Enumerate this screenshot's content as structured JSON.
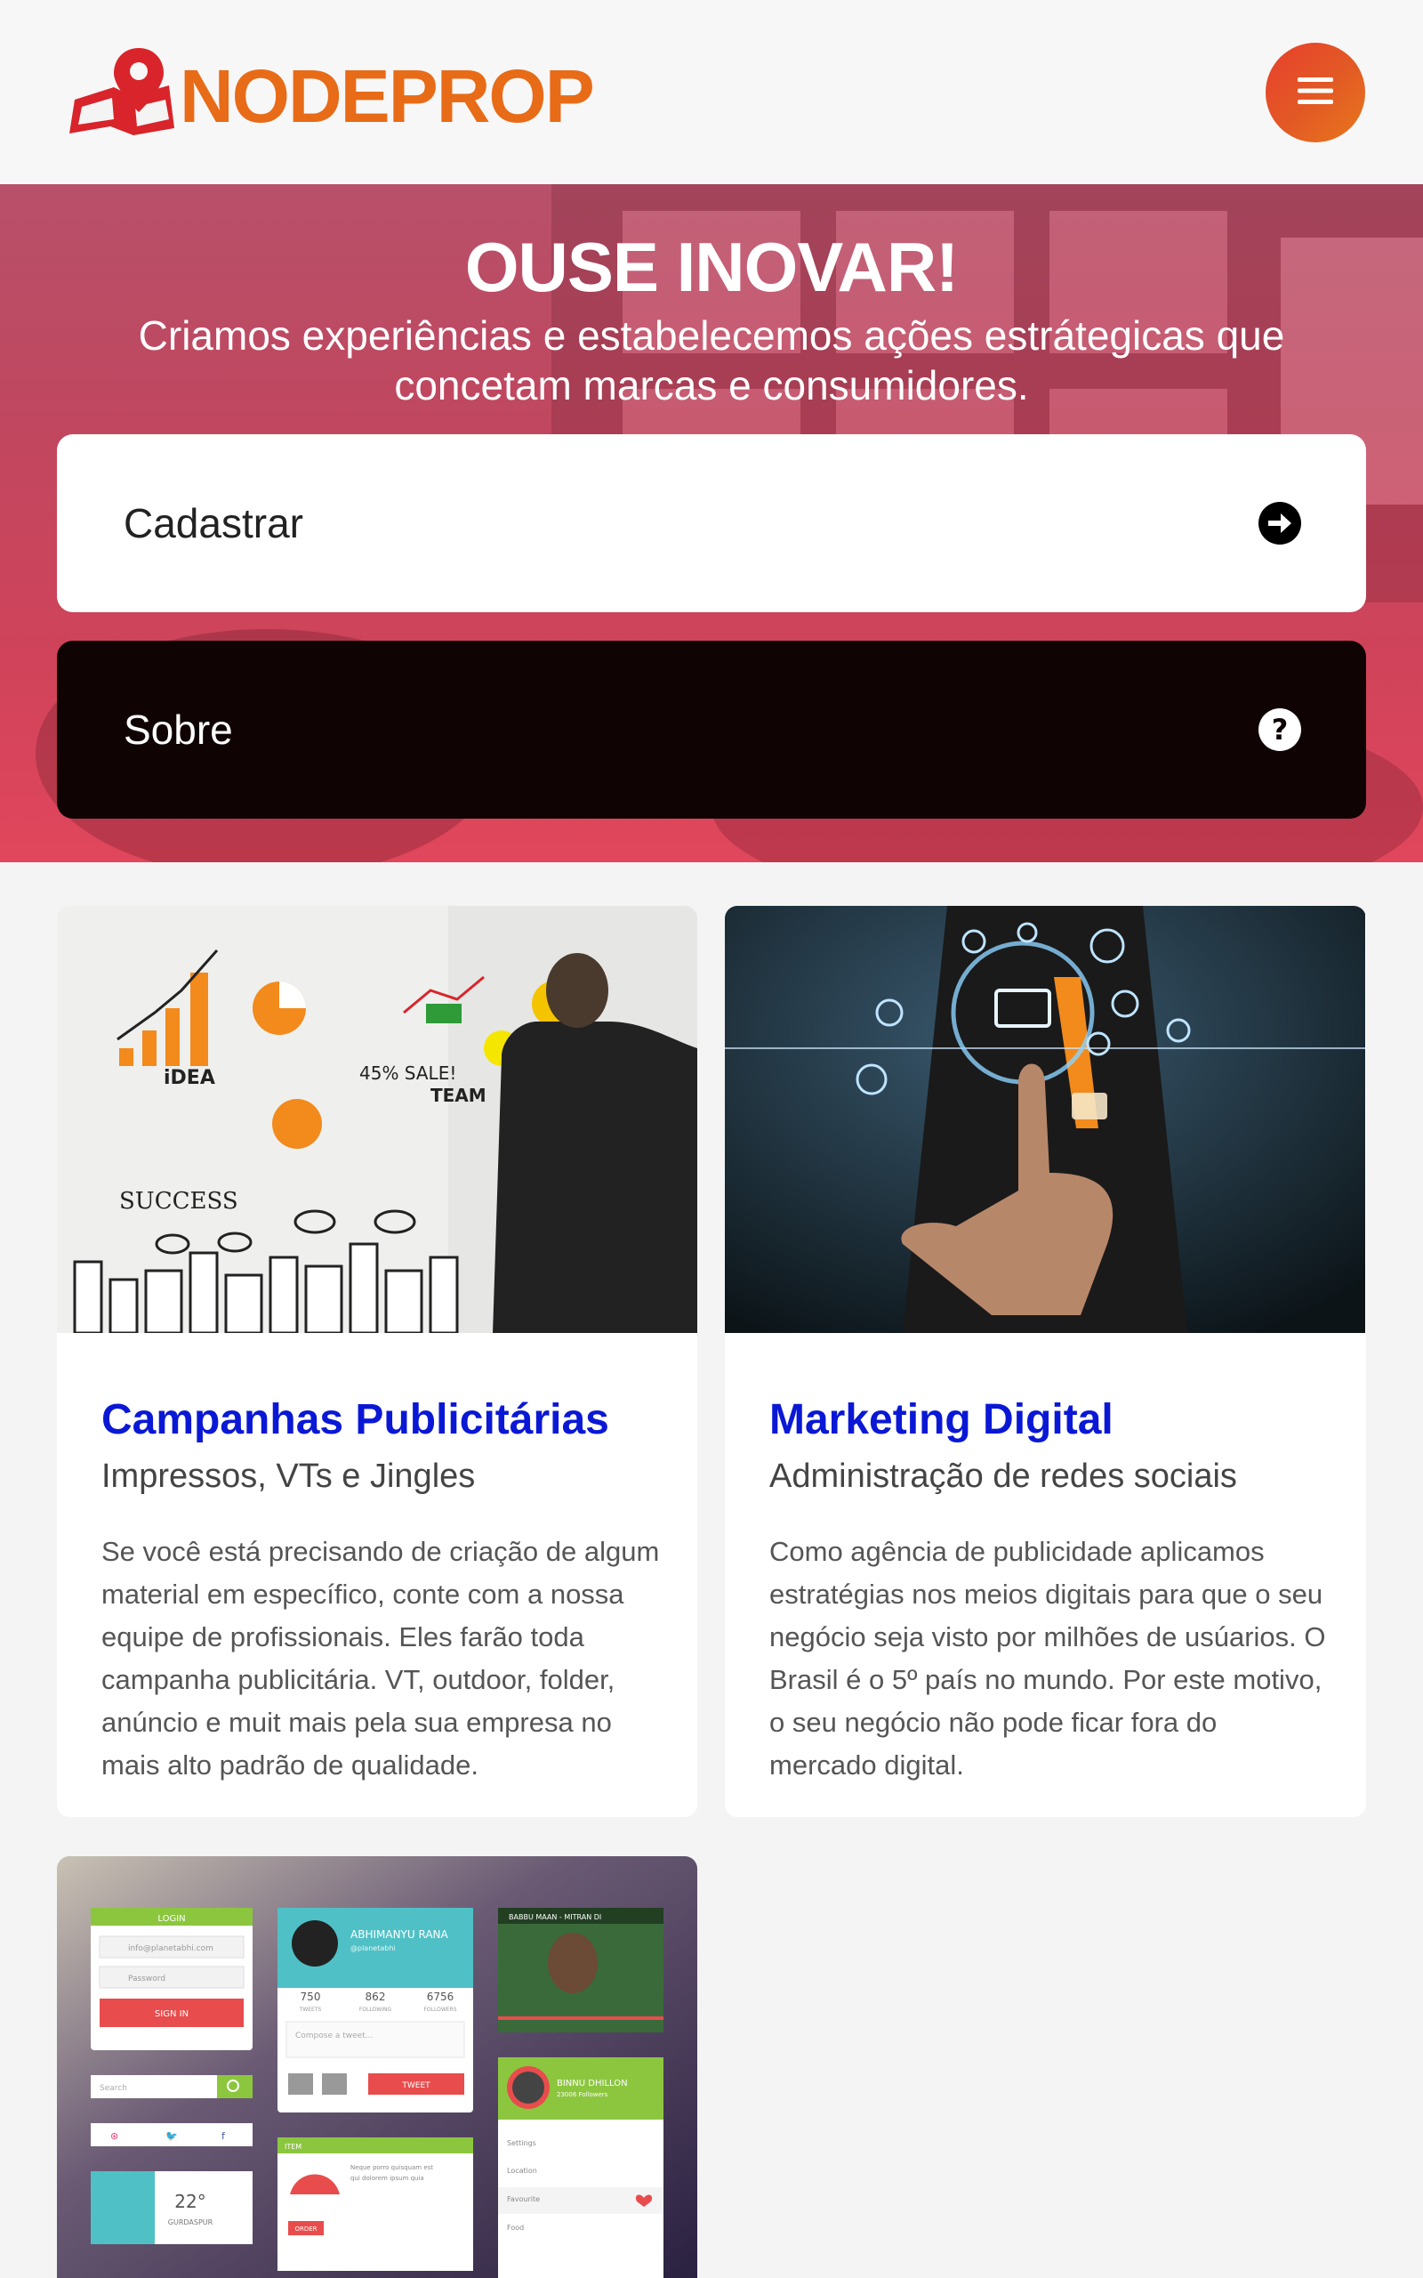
{
  "header": {
    "logo_text": "NODEPROP",
    "menu_icon": "hamburger-icon",
    "brand_color": "#e86b17"
  },
  "hero": {
    "title": "OUSE INOVAR!",
    "subtitle": "Criamos experiências e estabelecemos ações estrátegicas que concetam marcas e consumidores.",
    "cadastrar_label": "Cadastrar",
    "cadastrar_icon": "arrow-circle-right-icon",
    "sobre_label": "Sobre",
    "sobre_icon": "question-circle-icon"
  },
  "cards": [
    {
      "title": "Campanhas Publicitárias",
      "subtitle": "Impressos, VTs e Jingles",
      "text": "Se você está precisando de criação de algum material em específico, conte com a nossa equipe de profissionais. Eles farão toda campanha publicitária. VT, outdoor, folder, anúncio e muit mais pela sua empresa no mais alto padrão de qualidade."
    },
    {
      "title": "Marketing Digital",
      "subtitle": "Administração de redes sociais",
      "text": "Como agência de publicidade aplicamos estratégias nos meios digitais para que o seu negócio seja visto por milhões de usúarios. O Brasil é o 5º país no mundo. Por este motivo, o seu negócio não pode ficar fora do mercado digital."
    }
  ],
  "ui_kit": {
    "login_title": "LOGIN",
    "email_placeholder": "info@planetabhi.com",
    "password_placeholder": "Password",
    "sign_in": "SIGN IN",
    "search_placeholder": "Search",
    "profile_name": "ABHIMANYU RANA",
    "profile_handle": "@planetabhi",
    "stats": [
      {
        "value": "750",
        "label": "TWEETS"
      },
      {
        "value": "862",
        "label": "FOLLOWING"
      },
      {
        "value": "6756",
        "label": "FOLLOWERS"
      }
    ],
    "compose_placeholder": "Compose a tweet...",
    "tweet_btn": "TWEET",
    "video_title": "BABBU MAAN - MITRAN DI",
    "weather_temp": "22°",
    "weather_city": "GURDASPUR",
    "item_label": "ITEM",
    "item_text": "Neque porro quisquam est qui dolorem ipsum quia dolor sit amet, consectetur, adipisci velit ...",
    "order_btn": "ORDER",
    "user2_name": "BINNU DHILLON",
    "user2_followers": "23006 Followers",
    "menu_items": [
      "Settings",
      "Location",
      "Favourite",
      "Food"
    ]
  }
}
